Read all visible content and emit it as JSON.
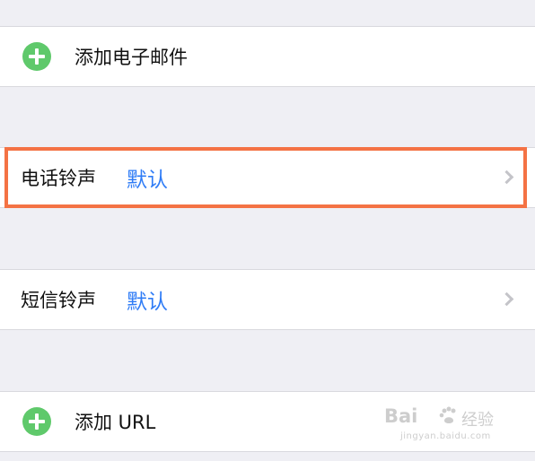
{
  "rows": {
    "add_email": {
      "label": "添加电子邮件",
      "icon": "plus-circle-icon"
    },
    "phone_ringtone": {
      "label": "电话铃声",
      "value": "默认",
      "icon": "chevron-right-icon"
    },
    "sms_ringtone": {
      "label": "短信铃声",
      "value": "默认",
      "icon": "chevron-right-icon"
    },
    "add_url": {
      "label": "添加 URL",
      "icon": "plus-circle-icon"
    }
  },
  "watermark": {
    "brand": "Bai",
    "cn": "经验",
    "url": "jingyan.baidu.com"
  },
  "colors": {
    "background": "#efeff4",
    "row": "#ffffff",
    "accent_blue": "#2f7cf6",
    "add_green": "#5fc96b",
    "highlight": "#f47244",
    "chevron": "#c4c4c9"
  }
}
